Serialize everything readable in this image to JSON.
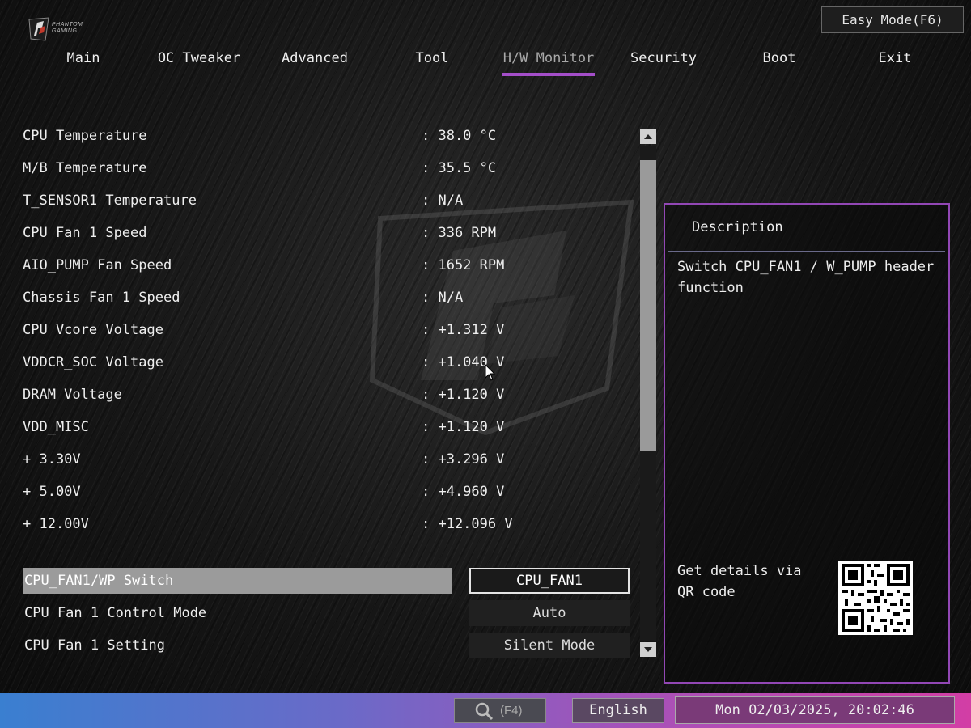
{
  "header": {
    "logo_text_line1": "PHANTOM",
    "logo_text_line2": "GAMING",
    "easy_mode_label": "Easy Mode(F6)"
  },
  "nav": {
    "tabs": [
      {
        "label": "Main"
      },
      {
        "label": "OC Tweaker"
      },
      {
        "label": "Advanced"
      },
      {
        "label": "Tool"
      },
      {
        "label": "H/W Monitor",
        "active": true
      },
      {
        "label": "Security"
      },
      {
        "label": "Boot"
      },
      {
        "label": "Exit"
      }
    ]
  },
  "monitor": {
    "rows": [
      {
        "label": "CPU Temperature",
        "value": ": 38.0 °C"
      },
      {
        "label": "M/B Temperature",
        "value": ": 35.5 °C"
      },
      {
        "label": "T_SENSOR1 Temperature",
        "value": ": N/A"
      },
      {
        "label": "CPU Fan 1 Speed",
        "value": ": 336 RPM"
      },
      {
        "label": "AIO_PUMP Fan Speed",
        "value": ": 1652 RPM"
      },
      {
        "label": "Chassis Fan 1 Speed",
        "value": ": N/A"
      },
      {
        "label": "CPU Vcore Voltage",
        "value": ": +1.312 V"
      },
      {
        "label": "VDDCR_SOC Voltage",
        "value": ": +1.040 V"
      },
      {
        "label": "DRAM Voltage",
        "value": ": +1.120 V"
      },
      {
        "label": "VDD_MISC",
        "value": ": +1.120 V"
      },
      {
        "label": "+ 3.30V",
        "value": ": +3.296 V"
      },
      {
        "label": "+ 5.00V",
        "value": ": +4.960 V"
      },
      {
        "label": "+ 12.00V",
        "value": ": +12.096 V"
      }
    ]
  },
  "options": [
    {
      "label": "CPU_FAN1/WP Switch",
      "value": "CPU_FAN1",
      "selected": true
    },
    {
      "label": "CPU Fan 1 Control Mode",
      "value": "Auto"
    },
    {
      "label": "CPU Fan 1 Setting",
      "value": "Silent Mode"
    }
  ],
  "description": {
    "title": "Description",
    "text": "Switch CPU_FAN1 / W_PUMP header function",
    "qr_text": "Get details via QR code"
  },
  "footer": {
    "search_key": "(F4)",
    "language": "English",
    "datetime": "Mon 02/03/2025, 20:02:46"
  },
  "colors": {
    "accent": "#a44ec9",
    "panel_border": "#9247b5",
    "selected_row": "#9b9b9b"
  },
  "icons": {
    "logo": "phantom-gaming-logo-icon",
    "search": "search-icon",
    "scroll_up": "arrow-up-icon",
    "scroll_down": "arrow-down-icon",
    "qr": "qr-code-icon",
    "cursor": "mouse-pointer-icon"
  }
}
